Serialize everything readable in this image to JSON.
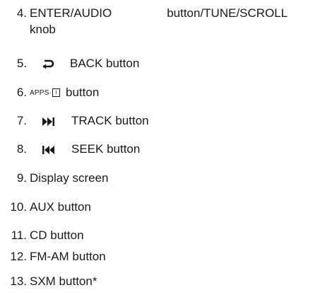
{
  "items": [
    {
      "number": "4.",
      "text_a": "ENTER/AUDIO",
      "text_b": "button/TUNE/SCROLL",
      "text_c": "knob"
    },
    {
      "number": "5.",
      "icon": "back-arrow-icon",
      "text": "BACK button"
    },
    {
      "number": "6.",
      "badge": "APPS·",
      "badge_box": "i",
      "text": "button"
    },
    {
      "number": "7.",
      "icon": "next-track-icon",
      "text": "TRACK button"
    },
    {
      "number": "8.",
      "icon": "seek-back-icon",
      "text": "SEEK button"
    },
    {
      "number": "9.",
      "text": "Display screen"
    },
    {
      "number": "10.",
      "text": "AUX button"
    },
    {
      "number": "11.",
      "text": "CD button"
    },
    {
      "number": "12.",
      "text": "FM-AM button"
    },
    {
      "number": "13.",
      "text": "SXM button*"
    }
  ]
}
